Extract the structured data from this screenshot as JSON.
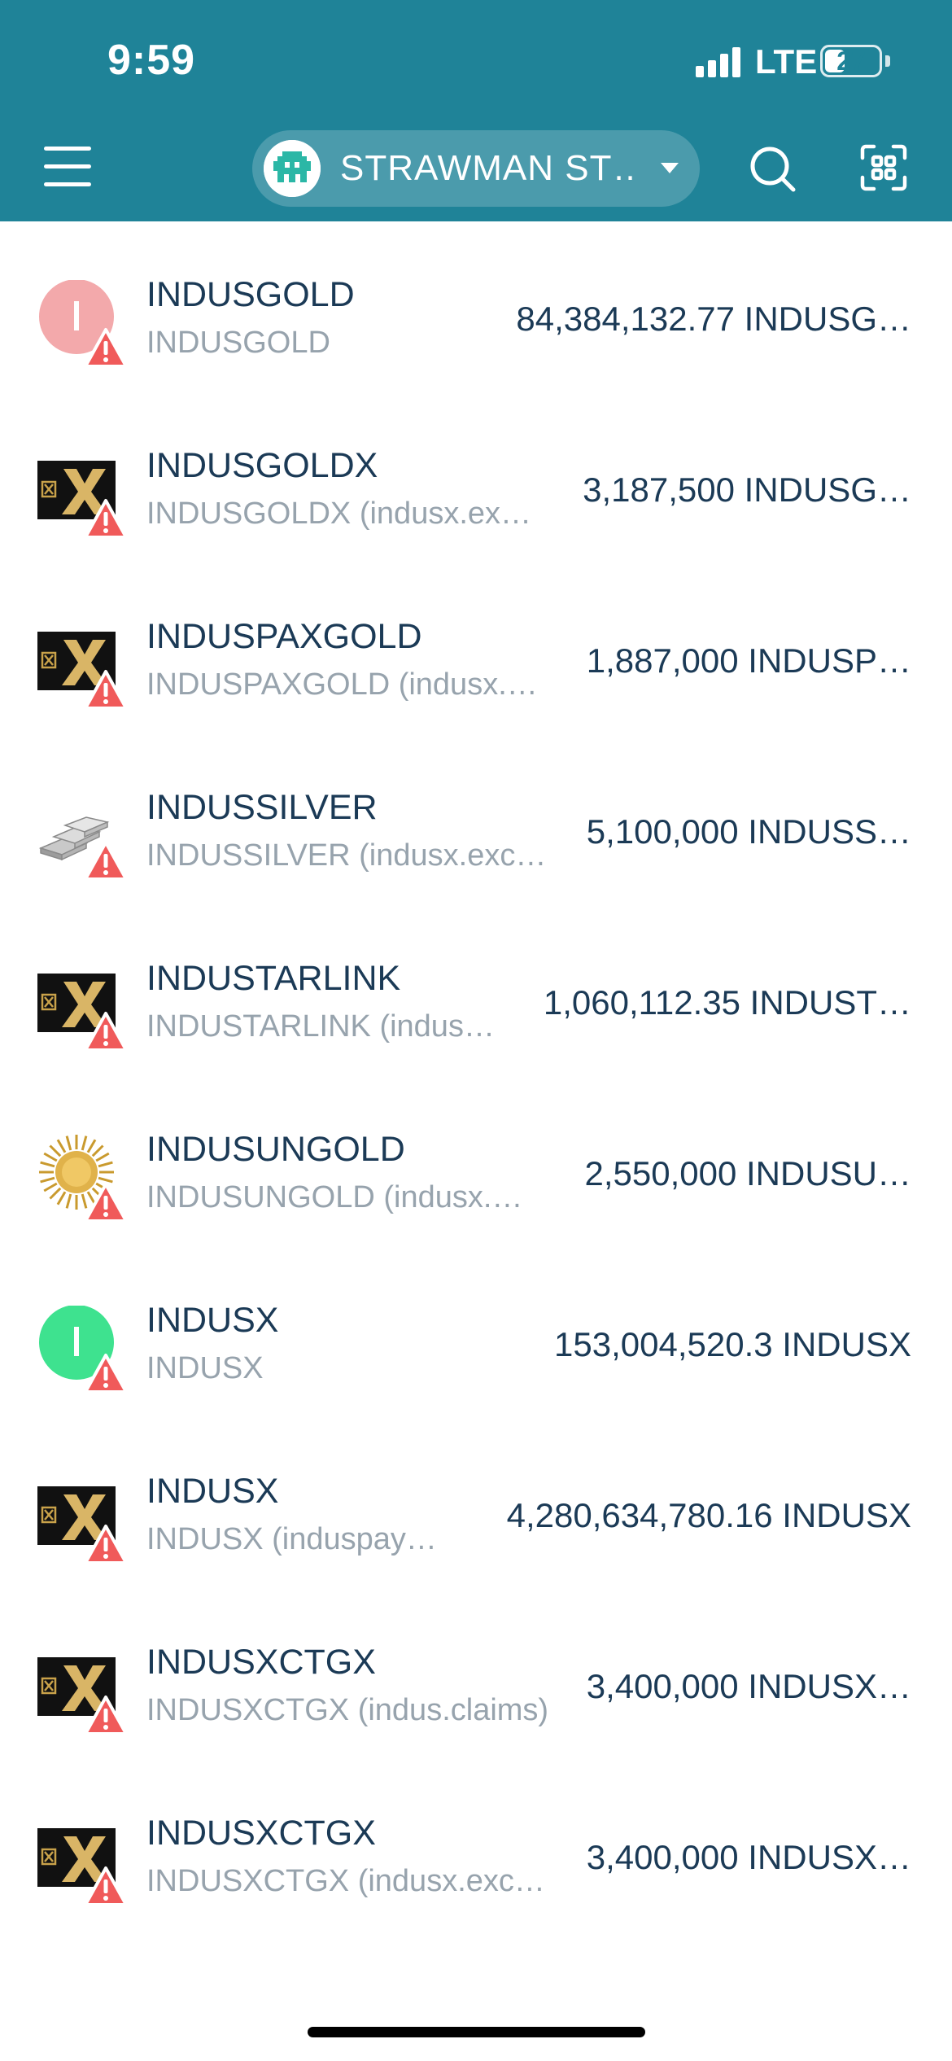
{
  "status_bar": {
    "time": "9:59",
    "network": "LTE",
    "battery": "27"
  },
  "header": {
    "account_name": "STRAWMAN ST…"
  },
  "tokens": [
    {
      "name": "INDUSGOLD",
      "subtitle": "INDUSGOLD",
      "balance": "84,384,132.77 INDUSG…",
      "icon": "letter-i-pink-icon"
    },
    {
      "name": "INDUSGOLDX",
      "subtitle": "INDUSGOLDX (indusx.ex…",
      "balance": "3,187,500 INDUSG…",
      "icon": "gold-x-logo-icon"
    },
    {
      "name": "INDUSPAXGOLD",
      "subtitle": "INDUSPAXGOLD (indusx.…",
      "balance": "1,887,000 INDUSP…",
      "icon": "gold-x-logo-icon"
    },
    {
      "name": "INDUSSILVER",
      "subtitle": "INDUSSILVER (indusx.exc…",
      "balance": "5,100,000 INDUSS…",
      "icon": "silver-bars-icon"
    },
    {
      "name": "INDUSTARLINK",
      "subtitle": "INDUSTARLINK (indus…",
      "balance": "1,060,112.35 INDUST…",
      "icon": "gold-x-logo-icon"
    },
    {
      "name": "INDUSUNGOLD",
      "subtitle": "INDUSUNGOLD (indusx.…",
      "balance": "2,550,000 INDUSU…",
      "icon": "gold-sun-icon"
    },
    {
      "name": "INDUSX",
      "subtitle": "INDUSX",
      "balance": "153,004,520.3 INDUSX",
      "icon": "letter-i-green-icon"
    },
    {
      "name": "INDUSX",
      "subtitle": "INDUSX (induspay…",
      "balance": "4,280,634,780.16 INDUSX",
      "icon": "gold-x-logo-icon"
    },
    {
      "name": "INDUSXCTGX",
      "subtitle": "INDUSXCTGX (indus.claims)",
      "balance": "3,400,000 INDUSX…",
      "icon": "gold-x-logo-icon"
    },
    {
      "name": "INDUSXCTGX",
      "subtitle": "INDUSXCTGX (indusx.exc…",
      "balance": "3,400,000 INDUSX…",
      "icon": "gold-x-logo-icon"
    }
  ],
  "colors": {
    "header": "#1f8398",
    "text_primary": "#1b3a56",
    "text_secondary": "#97a3ad",
    "warning": "#f05a5a"
  }
}
